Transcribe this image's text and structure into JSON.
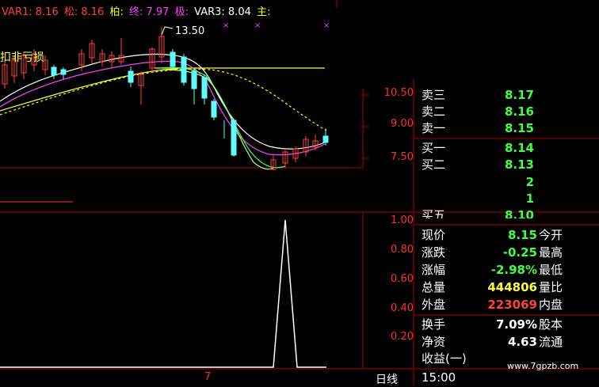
{
  "header": {
    "var1_label": "VAR1: 8.16",
    "song_label": "松: 8.16",
    "bai_label": "柏:",
    "zhong_label": "终: 7.97",
    "ji_label": "极:",
    "var3_label": "VAR3: 8.04",
    "zhu_label": "主:"
  },
  "main_chart": {
    "annotation": "扣非亏损",
    "peak_label": "13.50",
    "y_ticks": [
      "10.50",
      "9.00",
      "7.50"
    ]
  },
  "sub_chart": {
    "y_ticks": [
      "1.00",
      "0.80",
      "0.60",
      "0.40",
      "0.20"
    ]
  },
  "bottom_bar": {
    "date_marker": "7",
    "period_label": "日线",
    "time_label": "15:00"
  },
  "quote_panel": {
    "order_book": [
      {
        "label": "卖三",
        "value": "8.17",
        "color": "#40ff40"
      },
      {
        "label": "卖二",
        "value": "8.16",
        "color": "#40ff40"
      },
      {
        "label": "卖一",
        "value": "8.15",
        "color": "#40ff40"
      },
      {
        "label": "买一",
        "value": "8.14",
        "color": "#40ff40"
      },
      {
        "label": "买二",
        "value": "8.13",
        "color": "#40ff40"
      },
      {
        "label": "",
        "value": "2",
        "color": "#40ff40"
      },
      {
        "label": "",
        "value": "1",
        "color": "#40ff40"
      },
      {
        "label": "买五",
        "value": "8.10",
        "color": "#40ff40"
      }
    ],
    "stats": [
      {
        "label": "现价",
        "value": "8.15",
        "color": "#40ff40",
        "right_label": "今开"
      },
      {
        "label": "涨跌",
        "value": "-0.25",
        "color": "#40ff40",
        "right_label": "最高"
      },
      {
        "label": "涨幅",
        "value": "-2.98%",
        "color": "#40ff40",
        "right_label": "最低"
      },
      {
        "label": "总量",
        "value": "444806",
        "color": "#ffff40",
        "right_label": "量比"
      },
      {
        "label": "外盘",
        "value": "223069",
        "color": "#ff4040",
        "right_label": "内盘"
      },
      {
        "label": "换手",
        "value": "7.09%",
        "color": "#ffffff",
        "right_label": "股本"
      },
      {
        "label": "净资",
        "value": "4.63",
        "color": "#ffffff",
        "right_label": "流通"
      },
      {
        "label": "收益(一)",
        "value": "",
        "color": "#ffffff",
        "right_label": ""
      }
    ]
  },
  "watermark": "www.7gpzb.com"
}
